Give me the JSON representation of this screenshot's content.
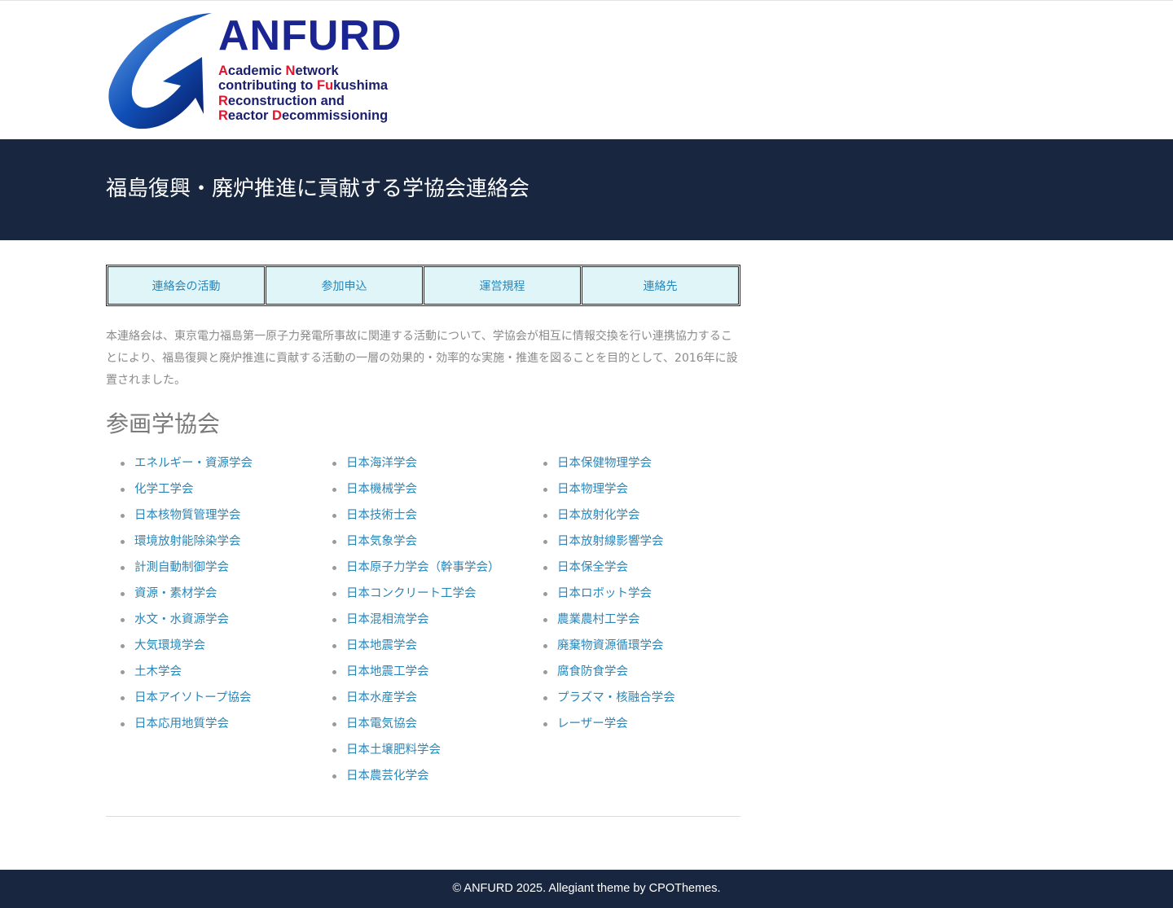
{
  "logo": {
    "title": "ANFURD",
    "lines": [
      {
        "acc": "A",
        "rest": "cademic ",
        "acc2": "N",
        "rest2": "etwork"
      },
      {
        "acc": "",
        "rest": "contributing to ",
        "acc2": "Fu",
        "rest2": "kushima"
      },
      {
        "acc": "R",
        "rest": "econstruction and",
        "acc2": "",
        "rest2": ""
      },
      {
        "acc": "R",
        "rest": "eactor ",
        "acc2": "D",
        "rest2": "ecommissioning"
      }
    ],
    "colors": {
      "title": "#1a2592",
      "accent": "#e2142d",
      "swoosh": "#0d3f9a"
    }
  },
  "banner": {
    "title": "福島復興・廃炉推進に貢献する学協会連絡会"
  },
  "nav": [
    {
      "label": "連絡会の活動"
    },
    {
      "label": "参加申込"
    },
    {
      "label": "運営規程"
    },
    {
      "label": "連絡先"
    }
  ],
  "intro": "本連絡会は、東京電力福島第一原子力発電所事故に関連する活動について、学協会が相互に情報交換を行い連携協力することにより、福島復興と廃炉推進に貢献する活動の一層の効果的・効率的な実施・推進を図ることを目的として、2016年に設置されました。",
  "members": {
    "title": "参画学協会",
    "col1": [
      "エネルギー・資源学会",
      "化学工学会",
      "日本核物質管理学会",
      "環境放射能除染学会",
      "計測自動制御学会",
      "資源・素材学会",
      "水文・水資源学会",
      "大気環境学会",
      "土木学会",
      "日本アイソトープ協会",
      "日本応用地質学会"
    ],
    "col2": [
      "日本海洋学会",
      "日本機械学会",
      "日本技術士会",
      "日本気象学会",
      "日本原子力学会（幹事学会）",
      "日本コンクリート工学会",
      "日本混相流学会",
      "日本地震学会",
      "日本地震工学会",
      "日本水産学会",
      "日本電気協会",
      "日本土壌肥料学会",
      "日本農芸化学会"
    ],
    "col3": [
      "日本保健物理学会",
      "日本物理学会",
      "日本放射化学会",
      "日本放射線影響学会",
      "日本保全学会",
      "日本ロボット学会",
      "農業農村工学会",
      "廃棄物資源循環学会",
      "腐食防食学会",
      "プラズマ・核融合学会",
      "レーザー学会"
    ]
  },
  "footer": {
    "text": "© ANFURD 2025. Allegiant theme by CPOThemes."
  },
  "theme": {
    "banner_bg": "#182640",
    "link": "#2a86b8",
    "nav_bg": "#dff5f8"
  }
}
